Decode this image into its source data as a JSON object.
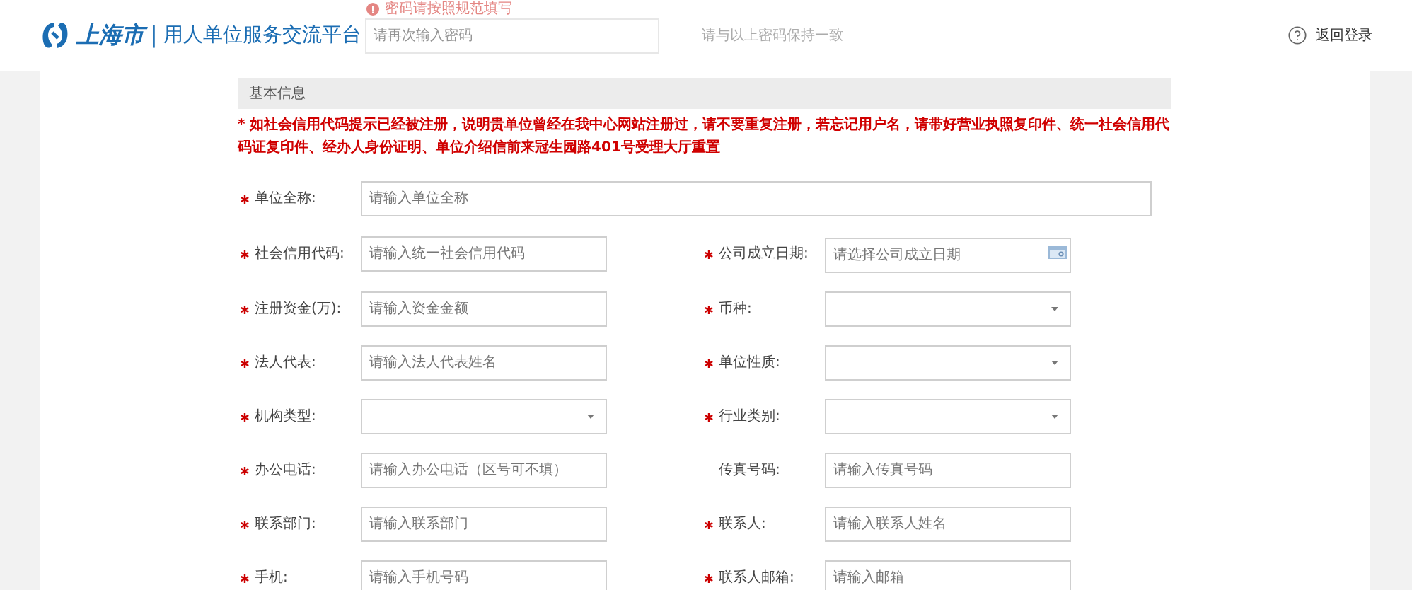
{
  "header": {
    "logo_city": "上海市",
    "logo_divider": "|",
    "logo_title": "用人单位服务交流平台",
    "back_link": "返回登录"
  },
  "ghost_field": {
    "error": "密码请按照规范填写",
    "placeholder": "请再次输入密码",
    "hint": "请与以上密码保持一致"
  },
  "section": {
    "title": "基本信息",
    "note": "* 如社会信用代码提示已经被注册，说明贵单位曾经在我中心网站注册过，请不要重复注册，若忘记用户名，请带好营业执照复印件、统一社会信用代码证复印件、经办人身份证明、单位介绍信前来冠生园路401号受理大厅重置"
  },
  "rows": [
    {
      "fields": [
        {
          "label": "单位全称:",
          "required": true,
          "kind": "text",
          "placeholder": "请输入单位全称",
          "wide": true
        }
      ]
    },
    {
      "fields": [
        {
          "label": "社会信用代码:",
          "required": true,
          "kind": "text",
          "placeholder": "请输入统一社会信用代码"
        },
        {
          "label": "公司成立日期:",
          "required": true,
          "kind": "date",
          "placeholder": "请选择公司成立日期"
        }
      ]
    },
    {
      "fields": [
        {
          "label": "注册资金(万):",
          "required": true,
          "kind": "text",
          "placeholder": "请输入资金金额"
        },
        {
          "label": "币种:",
          "required": true,
          "kind": "select"
        }
      ]
    },
    {
      "fields": [
        {
          "label": "法人代表:",
          "required": true,
          "kind": "text",
          "placeholder": "请输入法人代表姓名"
        },
        {
          "label": "单位性质:",
          "required": true,
          "kind": "select"
        }
      ]
    },
    {
      "fields": [
        {
          "label": "机构类型:",
          "required": true,
          "kind": "select"
        },
        {
          "label": "行业类别:",
          "required": true,
          "kind": "select"
        }
      ]
    },
    {
      "fields": [
        {
          "label": "办公电话:",
          "required": true,
          "kind": "text",
          "placeholder": "请输入办公电话（区号可不填）"
        },
        {
          "label": "传真号码:",
          "required": false,
          "kind": "text",
          "placeholder": "请输入传真号码"
        }
      ]
    },
    {
      "fields": [
        {
          "label": "联系部门:",
          "required": true,
          "kind": "text",
          "placeholder": "请输入联系部门"
        },
        {
          "label": "联系人:",
          "required": true,
          "kind": "text",
          "placeholder": "请输入联系人姓名"
        }
      ]
    },
    {
      "fields": [
        {
          "label": "手机:",
          "required": true,
          "kind": "text",
          "placeholder": "请输入手机号码"
        },
        {
          "label": "联系人邮箱:",
          "required": true,
          "kind": "text",
          "placeholder": "请输入邮箱"
        }
      ]
    }
  ]
}
